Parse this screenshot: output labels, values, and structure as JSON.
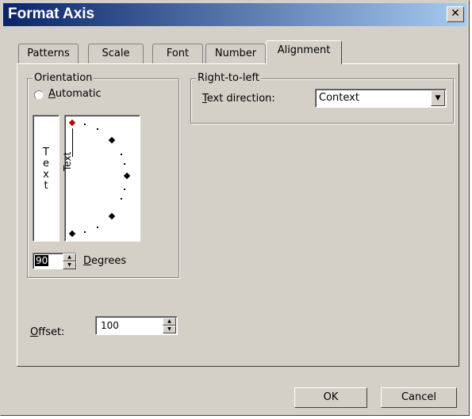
{
  "window": {
    "title": "Format Axis",
    "close_glyph": "✕"
  },
  "tabs": [
    {
      "label": "Patterns",
      "active": false
    },
    {
      "label": "Scale",
      "active": false
    },
    {
      "label": "Font",
      "active": false
    },
    {
      "label": "Number",
      "active": false
    },
    {
      "label": "Alignment",
      "active": true
    }
  ],
  "orientation": {
    "group_label": "Orientation",
    "automatic_label": "Automatic",
    "automatic_checked": false,
    "vertical_text": "Text",
    "rotated_text": "Text",
    "degrees_value": "90",
    "degrees_label": "Degrees"
  },
  "rtl": {
    "group_label": "Right-to-left",
    "direction_label": "Text direction:",
    "direction_value": "Context"
  },
  "offset": {
    "label": "Offset:",
    "value": "100"
  },
  "buttons": {
    "ok": "OK",
    "cancel": "Cancel"
  },
  "colors": {
    "title_start": "#0a246a",
    "title_end": "#a6caf0",
    "face": "#d4d0c8",
    "indicator": "#c00000"
  }
}
